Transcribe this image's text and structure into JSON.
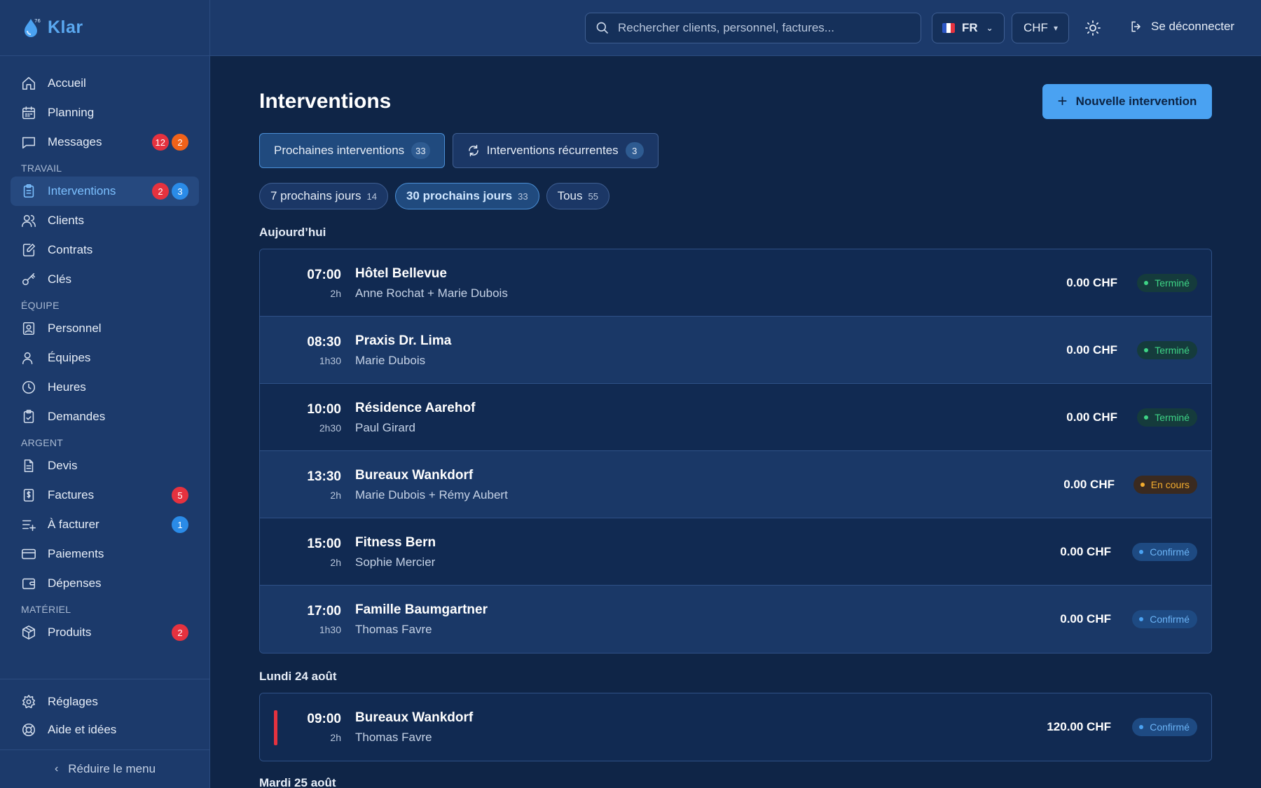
{
  "brand": {
    "name": "Klar",
    "sup": "76"
  },
  "sidebar": {
    "top_items": [
      {
        "label": "Accueil",
        "icon": "home-icon",
        "badges": []
      },
      {
        "label": "Planning",
        "icon": "calendar-icon",
        "badges": []
      },
      {
        "label": "Messages",
        "icon": "message-icon",
        "badges": [
          "12",
          "2"
        ]
      }
    ],
    "sections": [
      {
        "label": "TRAVAIL",
        "items": [
          {
            "label": "Interventions",
            "icon": "clipboard-icon",
            "badges": [
              "2",
              "3"
            ],
            "active": true
          },
          {
            "label": "Clients",
            "icon": "users-icon",
            "badges": []
          },
          {
            "label": "Contrats",
            "icon": "contract-icon",
            "badges": []
          },
          {
            "label": "Clés",
            "icon": "key-icon",
            "badges": []
          }
        ]
      },
      {
        "label": "ÉQUIPE",
        "items": [
          {
            "label": "Personnel",
            "icon": "id-card-icon",
            "badges": []
          },
          {
            "label": "Équipes",
            "icon": "team-icon",
            "badges": []
          },
          {
            "label": "Heures",
            "icon": "clock-icon",
            "badges": []
          },
          {
            "label": "Demandes",
            "icon": "request-icon",
            "badges": []
          }
        ]
      },
      {
        "label": "ARGENT",
        "items": [
          {
            "label": "Devis",
            "icon": "document-icon",
            "badges": []
          },
          {
            "label": "Factures",
            "icon": "invoice-icon",
            "badges": [
              "5"
            ]
          },
          {
            "label": "À facturer",
            "icon": "list-plus-icon",
            "badges": [
              "1"
            ]
          },
          {
            "label": "Paiements",
            "icon": "card-icon",
            "badges": []
          },
          {
            "label": "Dépenses",
            "icon": "wallet-icon",
            "badges": []
          }
        ]
      },
      {
        "label": "MATÉRIEL",
        "items": [
          {
            "label": "Produits",
            "icon": "box-icon",
            "badges": [
              "2"
            ]
          }
        ]
      }
    ],
    "bottom_items": [
      {
        "label": "Réglages",
        "icon": "gear-icon"
      },
      {
        "label": "Aide et idées",
        "icon": "help-icon"
      }
    ],
    "collapse_label": "Réduire le menu"
  },
  "topbar": {
    "search_placeholder": "Rechercher clients, personnel, factures...",
    "language": "FR",
    "currency": "CHF",
    "logout_label": "Se déconnecter"
  },
  "main": {
    "title": "Interventions",
    "new_button": "Nouvelle intervention",
    "tabs": [
      {
        "label": "Prochaines interventions",
        "count": "33"
      },
      {
        "label": "Interventions récurrentes",
        "count": "3"
      }
    ],
    "filters": [
      {
        "label": "7 prochains jours",
        "count": "14"
      },
      {
        "label": "30 prochains jours",
        "count": "33"
      },
      {
        "label": "Tous",
        "count": "55"
      }
    ],
    "days": [
      {
        "label": "Aujourd’hui",
        "rows": [
          {
            "time": "07:00",
            "duration": "2h",
            "client": "Hôtel Bellevue",
            "staff": "Anne Rochat + Marie Dubois",
            "amount": "0.00 CHF",
            "status": "Terminé",
            "kind": "done"
          },
          {
            "time": "08:30",
            "duration": "1h30",
            "client": "Praxis Dr. Lima",
            "staff": "Marie Dubois",
            "amount": "0.00 CHF",
            "status": "Terminé",
            "kind": "done"
          },
          {
            "time": "10:00",
            "duration": "2h30",
            "client": "Résidence Aarehof",
            "staff": "Paul Girard",
            "amount": "0.00 CHF",
            "status": "Terminé",
            "kind": "done"
          },
          {
            "time": "13:30",
            "duration": "2h",
            "client": "Bureaux Wankdorf",
            "staff": "Marie Dubois + Rémy Aubert",
            "amount": "0.00 CHF",
            "status": "En cours",
            "kind": "prog"
          },
          {
            "time": "15:00",
            "duration": "2h",
            "client": "Fitness Bern",
            "staff": "Sophie Mercier",
            "amount": "0.00 CHF",
            "status": "Confirmé",
            "kind": "conf"
          },
          {
            "time": "17:00",
            "duration": "1h30",
            "client": "Famille Baumgartner",
            "staff": "Thomas Favre",
            "amount": "0.00 CHF",
            "status": "Confirmé",
            "kind": "conf"
          }
        ]
      },
      {
        "label": "Lundi 24 août",
        "rows": [
          {
            "time": "09:00",
            "duration": "2h",
            "client": "Bureaux Wankdorf",
            "staff": "Thomas Favre",
            "amount": "120.00 CHF",
            "status": "Confirmé",
            "kind": "conf",
            "flag": true
          }
        ]
      },
      {
        "label": "Mardi 25 août",
        "rows": []
      }
    ]
  },
  "colors": {
    "accent": "#4aa2f2",
    "done": "#3ed486",
    "in_progress": "#f5ad2e",
    "confirmed": "#6bb3f5",
    "badge_red": "#e5323f"
  }
}
